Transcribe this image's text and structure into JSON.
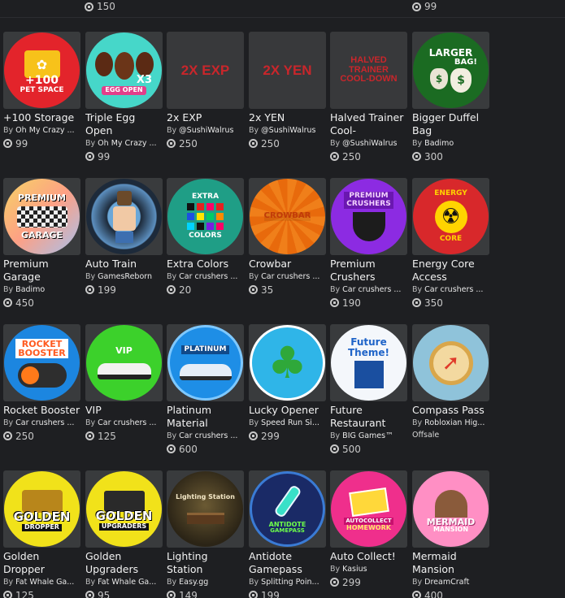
{
  "top_prices": [
    "150",
    "99"
  ],
  "items": [
    {
      "title": "+100 Storage",
      "by": "By",
      "creator": "Oh My Crazy ...",
      "price": "99",
      "thumb_text": [
        "+100",
        "PET SPACE"
      ],
      "icon": "pet-storage-icon"
    },
    {
      "title": "Triple Egg Open",
      "by": "By",
      "creator": "Oh My Crazy ...",
      "price": "99",
      "thumb_text": [
        "X3",
        "EGG OPEN"
      ],
      "icon": "egg-open-icon"
    },
    {
      "title": "2x EXP",
      "by": "By",
      "creator": "@SushiWalrus",
      "price": "250",
      "thumb_text": [
        "2x EXP"
      ],
      "icon": "double-exp-icon"
    },
    {
      "title": "2x YEN",
      "by": "By",
      "creator": "@SushiWalrus",
      "price": "250",
      "thumb_text": [
        "2x YEN"
      ],
      "icon": "double-yen-icon"
    },
    {
      "title": "Halved Trainer Cool-",
      "by": "By",
      "creator": "@SushiWalrus",
      "price": "250",
      "thumb_text": [
        "HALVED",
        "TRAINER",
        "COOL-DOWN"
      ],
      "icon": "cooldown-icon"
    },
    {
      "title": "Bigger Duffel Bag",
      "by": "By",
      "creator": "Badimo",
      "price": "300",
      "thumb_text": [
        "LARGER",
        "BAG!"
      ],
      "icon": "money-bag-icon"
    },
    {
      "title": "Premium Garage",
      "by": "By",
      "creator": "Badimo",
      "price": "450",
      "thumb_text": [
        "PREMIUM",
        "GARAGE"
      ],
      "icon": "garage-icon"
    },
    {
      "title": "Auto Train",
      "by": "By",
      "creator": "GamesReborn",
      "price": "199",
      "thumb_text": [],
      "icon": "auto-train-icon"
    },
    {
      "title": "Extra Colors",
      "by": "By",
      "creator": "Car crushers ...",
      "price": "20",
      "thumb_text": [
        "EXTRA",
        "COLORS"
      ],
      "icon": "color-palette-icon"
    },
    {
      "title": "Crowbar",
      "by": "By",
      "creator": "Car crushers ...",
      "price": "35",
      "thumb_text": [
        "CROWBAR"
      ],
      "icon": "crowbar-icon"
    },
    {
      "title": "Premium Crushers",
      "by": "By",
      "creator": "Car crushers ...",
      "price": "190",
      "thumb_text": [
        "PREMIUM",
        "CRUSHERS"
      ],
      "icon": "crusher-icon"
    },
    {
      "title": "Energy Core Access",
      "by": "By",
      "creator": "Car crushers ...",
      "price": "350",
      "thumb_text": [
        "ENERGY",
        "CORE"
      ],
      "icon": "radiation-icon"
    },
    {
      "title": "Rocket Booster",
      "by": "By",
      "creator": "Car crushers ...",
      "price": "250",
      "thumb_text": [
        "ROCKET",
        "BOOSTER"
      ],
      "icon": "rocket-booster-icon"
    },
    {
      "title": "VIP",
      "by": "By",
      "creator": "Car crushers ...",
      "price": "125",
      "thumb_text": [
        "VIP"
      ],
      "icon": "vip-car-icon"
    },
    {
      "title": "Platinum Material",
      "by": "By",
      "creator": "Car crushers ...",
      "price": "600",
      "thumb_text": [
        "PLATINUM"
      ],
      "icon": "platinum-car-icon"
    },
    {
      "title": "Lucky Opener",
      "by": "By",
      "creator": "Speed Run Si...",
      "price": "299",
      "thumb_text": [],
      "icon": "clover-icon"
    },
    {
      "title": "Future Restaurant",
      "by": "By",
      "creator": "BIG Games™",
      "price": "500",
      "thumb_text": [
        "Future",
        "Theme!"
      ],
      "icon": "future-theme-icon"
    },
    {
      "title": "Compass Pass",
      "by": "By",
      "creator": "Robloxian Hig...",
      "price": "",
      "offsale": "Offsale",
      "thumb_text": [],
      "icon": "compass-icon"
    },
    {
      "title": "Golden Dropper",
      "by": "By",
      "creator": "Fat Whale Ga...",
      "price": "125",
      "thumb_text": [
        "GOLDEN",
        "DROPPER"
      ],
      "icon": "golden-dropper-icon"
    },
    {
      "title": "Golden Upgraders",
      "by": "By",
      "creator": "Fat Whale Ga...",
      "price": "95",
      "thumb_text": [
        "GOLDEN",
        "UPGRADERS"
      ],
      "icon": "golden-upgrader-icon"
    },
    {
      "title": "Lighting Station",
      "by": "By",
      "creator": "Easy.gg",
      "price": "149",
      "thumb_text": [
        "Lighting Station"
      ],
      "icon": "lighting-station-icon"
    },
    {
      "title": "Antidote Gamepass",
      "by": "By",
      "creator": "Splitting Poin...",
      "price": "199",
      "thumb_text": [
        "ANTIDOTE",
        "GAMEPASS"
      ],
      "icon": "antidote-icon"
    },
    {
      "title": "Auto Collect!",
      "by": "By",
      "creator": "Kasius",
      "price": "299",
      "thumb_text": [
        "AUTOCOLLECT",
        "HOMEWORK"
      ],
      "icon": "homework-icon"
    },
    {
      "title": "Mermaid Mansion",
      "by": "By",
      "creator": "DreamCraft",
      "price": "400",
      "thumb_text": [
        "MERMAID",
        "MANSION"
      ],
      "icon": "mansion-icon"
    }
  ]
}
